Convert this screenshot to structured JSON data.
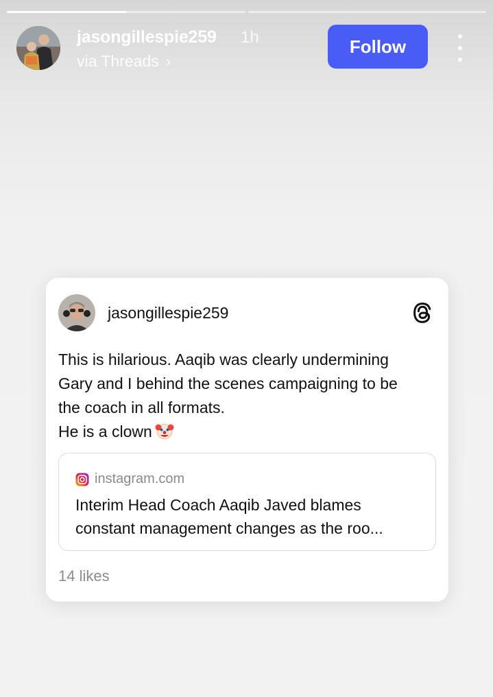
{
  "story": {
    "progress": [
      0.5,
      0.0
    ],
    "header": {
      "username": "jasongillespie259",
      "time": "1h",
      "via_label": "via Threads",
      "via_chevron": "›",
      "follow_label": "Follow",
      "more_icon": "more-vertical-icon"
    }
  },
  "post": {
    "username": "jasongillespie259",
    "platform_icon": "threads-icon",
    "text_lines": [
      "This is hilarious. Aaqib was clearly undermining",
      "Gary and I behind the scenes campaigning to be",
      "the coach in all formats.",
      "He is a clown"
    ],
    "emoji_icon": "clown-face-icon",
    "link": {
      "domain_icon": "instagram-icon",
      "domain": "instagram.com",
      "title_lines": [
        "Interim Head Coach Aaqib Javed blames",
        "constant management changes as the roo..."
      ]
    },
    "likes": "14 likes"
  },
  "colors": {
    "follow_button": "#4a5cf6",
    "background": "#f2f2f2",
    "card": "#ffffff",
    "muted_text": "#8c8c8c"
  }
}
